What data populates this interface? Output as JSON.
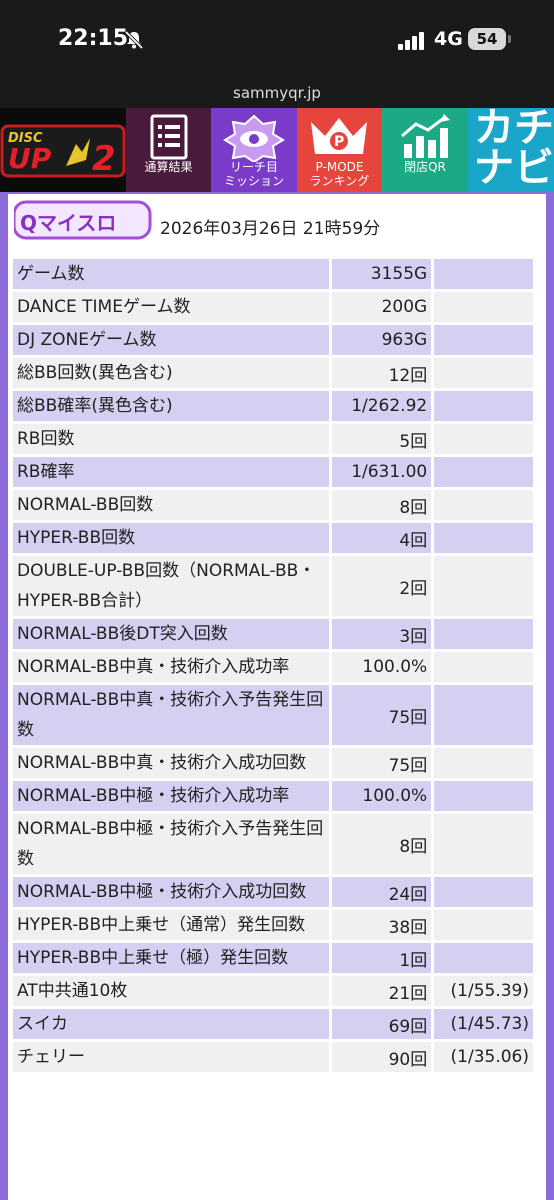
{
  "status_bar": {
    "time": "22:15",
    "network": "4G",
    "battery": "54"
  },
  "browser": {
    "url": "sammyqr.jp"
  },
  "nav": {
    "logo_text": "DISC UP 2",
    "items": [
      {
        "label": "通算結果"
      },
      {
        "label": "リーチ目\nミッション"
      },
      {
        "label": "P-MODE\nランキング"
      },
      {
        "label": "閉店QR"
      }
    ],
    "kachinavi": "カチナビ",
    "colors": {
      "tsusan": "#4a1a3d",
      "reach": "#7a3cc8",
      "pmode": "#e5453c",
      "heiten": "#1ca986"
    }
  },
  "header": {
    "logo_text": "Qマイスロ",
    "datetime": "2026年03月26日 21時59分"
  },
  "stats": [
    {
      "label": "ゲーム数",
      "value": "3155G",
      "extra": ""
    },
    {
      "label": "DANCE TIMEゲーム数",
      "value": "200G",
      "extra": ""
    },
    {
      "label": "DJ ZONEゲーム数",
      "value": "963G",
      "extra": ""
    },
    {
      "label": "総BB回数(異色含む)",
      "value": "12回",
      "extra": ""
    },
    {
      "label": "総BB確率(異色含む)",
      "value": "1/262.92",
      "extra": ""
    },
    {
      "label": "RB回数",
      "value": "5回",
      "extra": ""
    },
    {
      "label": "RB確率",
      "value": "1/631.00",
      "extra": ""
    },
    {
      "label": "NORMAL-BB回数",
      "value": "8回",
      "extra": ""
    },
    {
      "label": "HYPER-BB回数",
      "value": "4回",
      "extra": ""
    },
    {
      "label": "DOUBLE-UP-BB回数（NORMAL-BB・HYPER-BB合計）",
      "value": "2回",
      "extra": ""
    },
    {
      "label": "NORMAL-BB後DT突入回数",
      "value": "3回",
      "extra": ""
    },
    {
      "label": "NORMAL-BB中真・技術介入成功率",
      "value": "100.0%",
      "extra": ""
    },
    {
      "label": "NORMAL-BB中真・技術介入予告発生回数",
      "value": "75回",
      "extra": ""
    },
    {
      "label": "NORMAL-BB中真・技術介入成功回数",
      "value": "75回",
      "extra": ""
    },
    {
      "label": "NORMAL-BB中極・技術介入成功率",
      "value": "100.0%",
      "extra": ""
    },
    {
      "label": "NORMAL-BB中極・技術介入予告発生回数",
      "value": "8回",
      "extra": ""
    },
    {
      "label": "NORMAL-BB中極・技術介入成功回数",
      "value": "24回",
      "extra": ""
    },
    {
      "label": "HYPER-BB中上乗せ（通常）発生回数",
      "value": "38回",
      "extra": ""
    },
    {
      "label": "HYPER-BB中上乗せ（極）発生回数",
      "value": "1回",
      "extra": ""
    },
    {
      "label": "AT中共通10枚",
      "value": "21回",
      "extra": "(1/55.39)"
    },
    {
      "label": "スイカ",
      "value": "69回",
      "extra": "(1/45.73)"
    },
    {
      "label": "チェリー",
      "value": "90回",
      "extra": "(1/35.06)"
    }
  ]
}
